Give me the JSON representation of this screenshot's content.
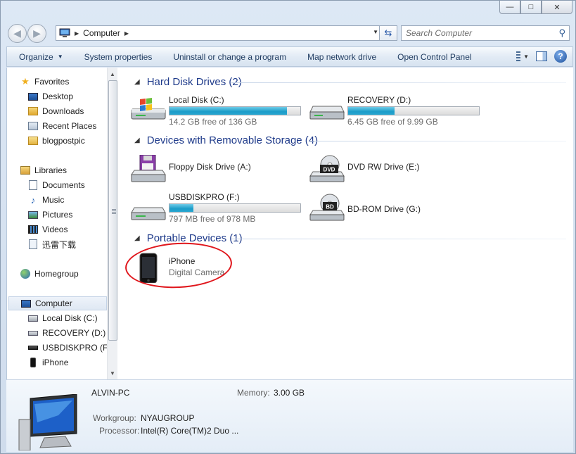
{
  "window": {
    "minimize_glyph": "—",
    "maximize_glyph": "□",
    "close_glyph": "✕"
  },
  "address": {
    "location": "Computer"
  },
  "search": {
    "placeholder": "Search Computer"
  },
  "toolbar": {
    "organize": "Organize",
    "system_properties": "System properties",
    "uninstall": "Uninstall or change a program",
    "map_drive": "Map network drive",
    "control_panel": "Open Control Panel"
  },
  "sidebar": {
    "favorites": "Favorites",
    "desktop": "Desktop",
    "downloads": "Downloads",
    "recent_places": "Recent Places",
    "blogpostpic": "blogpostpic",
    "libraries": "Libraries",
    "documents": "Documents",
    "music": "Music",
    "pictures": "Pictures",
    "videos": "Videos",
    "xunlei": "迅雷下载",
    "homegroup": "Homegroup",
    "computer": "Computer",
    "local_disk": "Local Disk (C:)",
    "recovery": "RECOVERY (D:)",
    "usbdisk": "USBDISKPRO (F:)",
    "iphone": "iPhone"
  },
  "groups": {
    "hdd": "Hard Disk Drives (2)",
    "removable": "Devices with Removable Storage (4)",
    "portable": "Portable Devices (1)"
  },
  "drives": {
    "c": {
      "name": "Local Disk (C:)",
      "free": "14.2 GB free of 136 GB",
      "used_fraction": 0.896
    },
    "d": {
      "name": "RECOVERY (D:)",
      "free": "6.45 GB free of 9.99 GB",
      "used_fraction": 0.354
    },
    "floppy": {
      "name": "Floppy Disk Drive (A:)"
    },
    "dvd": {
      "name": "DVD RW Drive (E:)",
      "badge": "DVD"
    },
    "usb": {
      "name": "USBDISKPRO (F:)",
      "free": "797 MB free of 978 MB",
      "used_fraction": 0.185
    },
    "bd": {
      "name": "BD-ROM Drive (G:)",
      "badge": "BD"
    }
  },
  "portable": {
    "name": "iPhone",
    "type": "Digital Camera"
  },
  "details": {
    "pc_name": "ALVIN-PC",
    "memory_label": "Memory:",
    "memory_value": "3.00 GB",
    "workgroup_label": "Workgroup:",
    "workgroup_value": "NYAUGROUP",
    "processor_label": "Processor:",
    "processor_value": "Intel(R) Core(TM)2 Duo ..."
  },
  "colors": {
    "accent": "#1e3a8a",
    "bar_fill": "#1b9cc8",
    "annotation": "#e0161c"
  }
}
